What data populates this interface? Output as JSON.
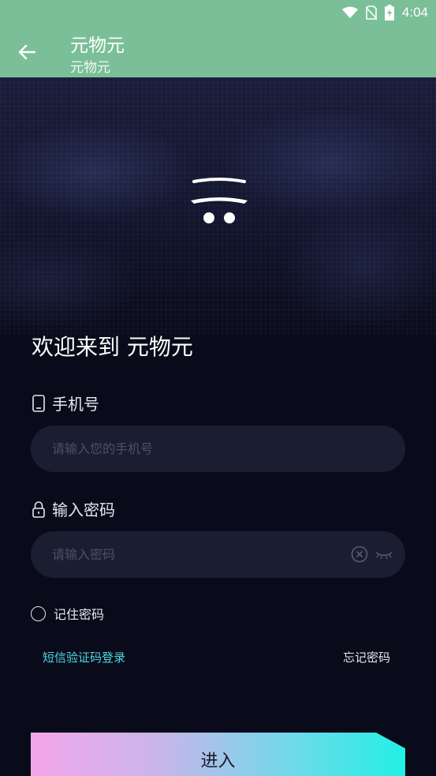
{
  "status_bar": {
    "time": "4:04",
    "icons": [
      "wifi-icon",
      "sim-no-signal-icon",
      "battery-charging-icon"
    ]
  },
  "app_bar": {
    "title": "元物元",
    "subtitle": "元物元",
    "back_icon": "arrow-left-icon"
  },
  "hero": {
    "logo_icon": "app-logo-icon"
  },
  "login": {
    "welcome": "欢迎来到 元物元",
    "phone_label": "手机号",
    "phone_icon": "mobile-phone-icon",
    "phone_placeholder": "请输入您的手机号",
    "phone_value": "",
    "password_label": "输入密码",
    "password_icon": "lock-icon",
    "password_placeholder": "请输入密码",
    "password_value": "",
    "clear_icon": "clear-circle-icon",
    "visibility_icon": "eye-closed-icon",
    "remember_label": "记住密码",
    "remember_checked": false,
    "sms_login": "短信验证码登录",
    "forgot_password": "忘记密码",
    "submit": "进入"
  },
  "colors": {
    "app_bar": "#7bbf98",
    "background": "#0a0b1a",
    "input_bg": "#1b1d31",
    "link_accent": "#4fd6e4",
    "button_gradient_start": "#f3a6ea",
    "button_gradient_end": "#22f0e4"
  }
}
